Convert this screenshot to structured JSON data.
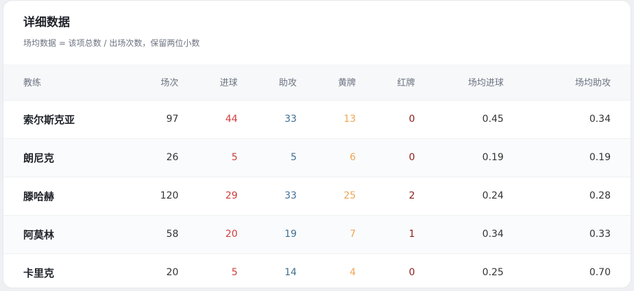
{
  "panel": {
    "title": "详细数据",
    "subtitle": "场均数据 = 该项总数 / 出场次数，保留两位小数"
  },
  "table": {
    "headers": [
      "教练",
      "场次",
      "进球",
      "助攻",
      "黄牌",
      "红牌",
      "场均进球",
      "场均助攻"
    ],
    "rows": [
      {
        "coach": "索尔斯克亚",
        "matches": "97",
        "goals": "44",
        "assists": "33",
        "yellow": "13",
        "red": "0",
        "avg_goals": "0.45",
        "avg_assists": "0.34"
      },
      {
        "coach": "朗尼克",
        "matches": "26",
        "goals": "5",
        "assists": "5",
        "yellow": "6",
        "red": "0",
        "avg_goals": "0.19",
        "avg_assists": "0.19"
      },
      {
        "coach": "滕哈赫",
        "matches": "120",
        "goals": "29",
        "assists": "33",
        "yellow": "25",
        "red": "2",
        "avg_goals": "0.24",
        "avg_assists": "0.28"
      },
      {
        "coach": "阿莫林",
        "matches": "58",
        "goals": "20",
        "assists": "19",
        "yellow": "7",
        "red": "1",
        "avg_goals": "0.34",
        "avg_assists": "0.33"
      },
      {
        "coach": "卡里克",
        "matches": "20",
        "goals": "5",
        "assists": "14",
        "yellow": "4",
        "red": "0",
        "avg_goals": "0.25",
        "avg_assists": "0.70"
      }
    ]
  },
  "colors": {
    "goals": "#d13b3b",
    "assists": "#3f6f93",
    "yellow": "#f0a455",
    "red": "#8b1a1a"
  }
}
